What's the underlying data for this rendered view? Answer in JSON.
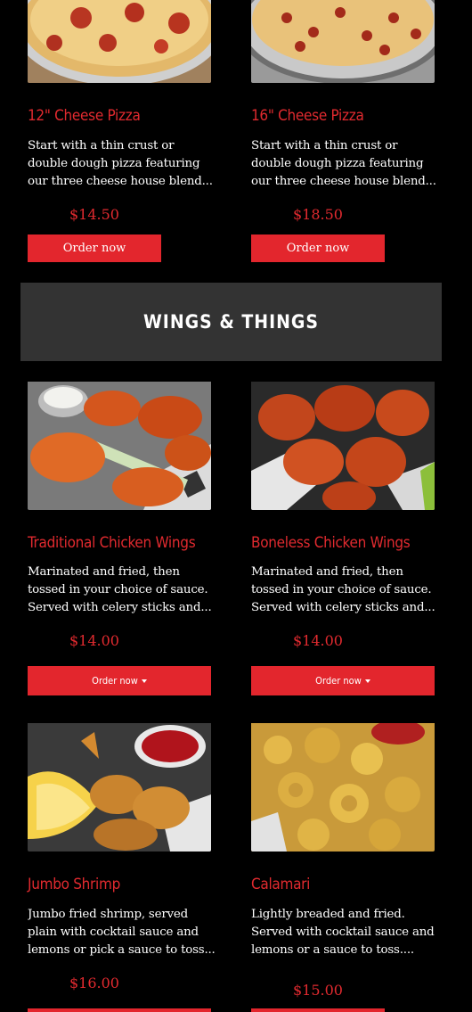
{
  "pizza": {
    "items": [
      {
        "title": "12\" Cheese Pizza",
        "desc": [
          "Start with a thin crust or",
          "double dough pizza featuring",
          "our three cheese house blend..."
        ],
        "price": "$14.50",
        "button": "Order now"
      },
      {
        "title": "16\" Cheese Pizza",
        "desc": [
          "Start with a thin crust or",
          "double dough pizza featuring",
          "our three cheese house blend..."
        ],
        "price": "$18.50",
        "button": "Order now"
      }
    ]
  },
  "section": {
    "heading": "WINGS & THINGS"
  },
  "wings": {
    "items": [
      {
        "title": "Traditional Chicken Wings",
        "desc": [
          "Marinated and fried, then",
          "tossed in your choice of sauce.",
          "Served with celery sticks and..."
        ],
        "price": "$14.00",
        "button": "Order now"
      },
      {
        "title": "Boneless Chicken Wings",
        "desc": [
          "Marinated and fried, then",
          "tossed in your choice of sauce.",
          "Served with celery sticks and..."
        ],
        "price": "$14.00",
        "button": "Order now"
      },
      {
        "title": "Jumbo Shrimp",
        "desc": [
          "Jumbo fried shrimp, served",
          "plain with cocktail sauce and",
          "lemons or pick a sauce to toss..."
        ],
        "price": "$16.00"
      },
      {
        "title": "Calamari",
        "desc": [
          "Lightly breaded and fried.",
          "Served with cocktail sauce and",
          "lemons or a sauce to toss...."
        ],
        "price": "$15.00"
      }
    ]
  },
  "colors": {
    "accent": "#e3262d",
    "title_red": "#e12a2f",
    "section_bg": "#333333",
    "page_bg": "#000000"
  },
  "icons": {
    "dropdown": "caret-down-icon"
  }
}
